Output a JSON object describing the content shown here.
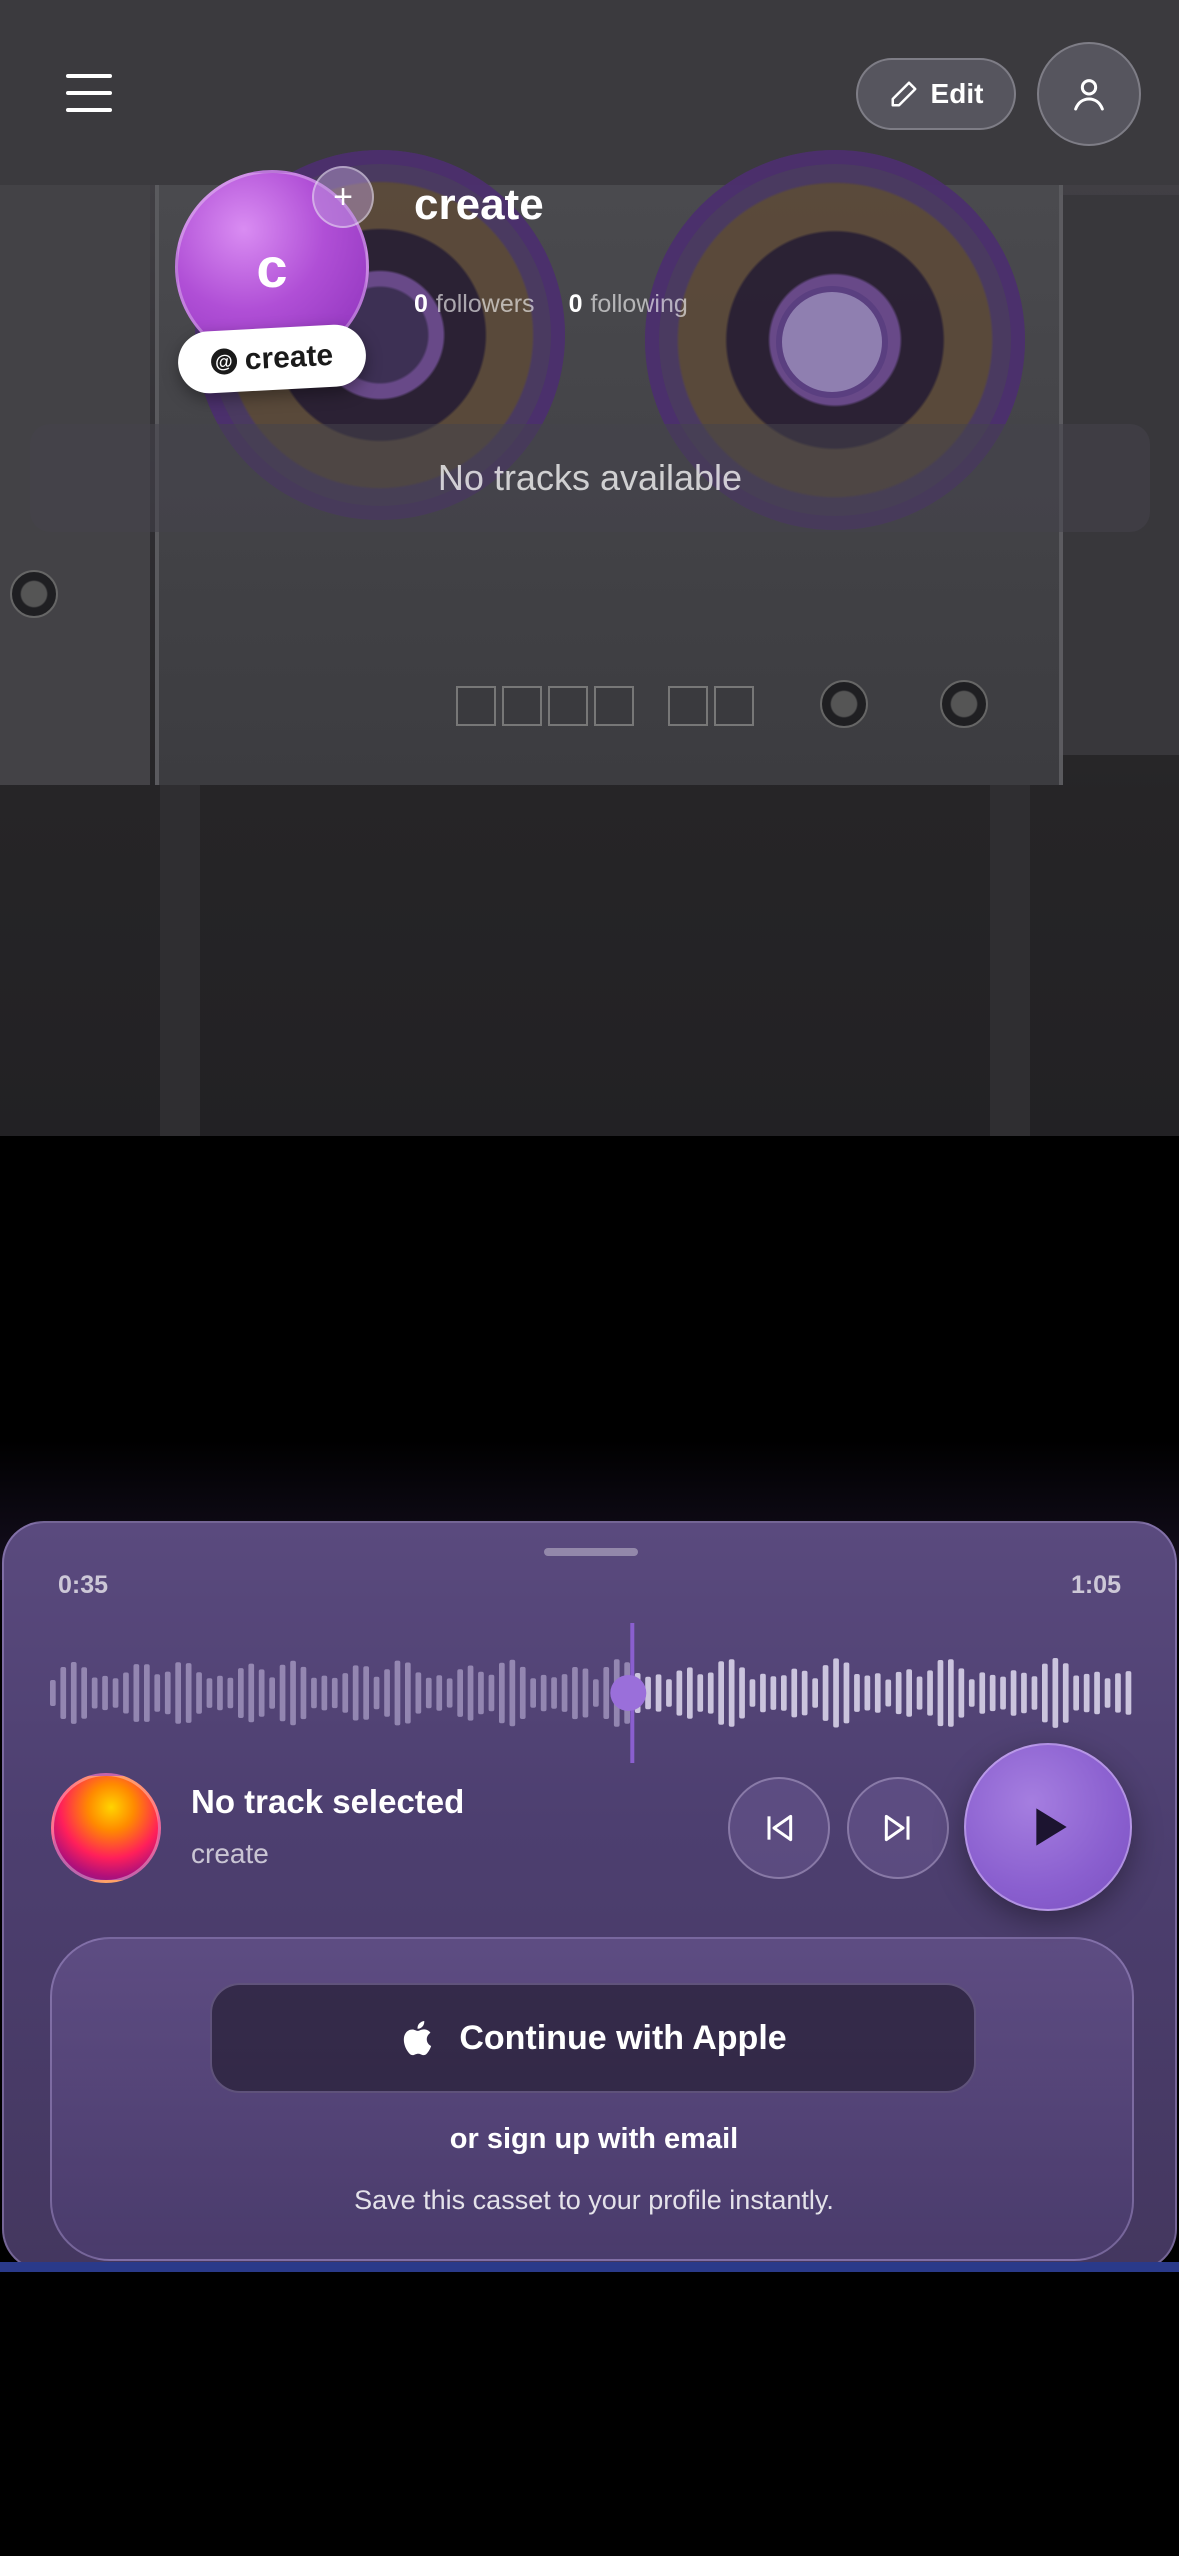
{
  "header": {
    "edit_label": "Edit"
  },
  "profile": {
    "avatar_initial": "c",
    "avatar_add": "+",
    "name": "create",
    "handle": "create",
    "followers_count": "0",
    "followers_label": "followers",
    "following_count": "0",
    "following_label": "following",
    "empty_tracks": "No tracks available"
  },
  "player": {
    "elapsed": "0:35",
    "duration": "1:05",
    "progress": 0.538,
    "track_title": "No track selected",
    "track_artist": "create",
    "accent_color": "#8a5fcf"
  },
  "auth": {
    "apple_label": "Continue with Apple",
    "email_label": "or sign up with email",
    "subtitle": "Save this casset to your profile instantly."
  },
  "icons": [
    "menu-icon",
    "pencil-icon",
    "user-icon",
    "plus-icon",
    "at-icon",
    "apple-icon",
    "skip-back-icon",
    "skip-forward-icon",
    "play-icon"
  ]
}
